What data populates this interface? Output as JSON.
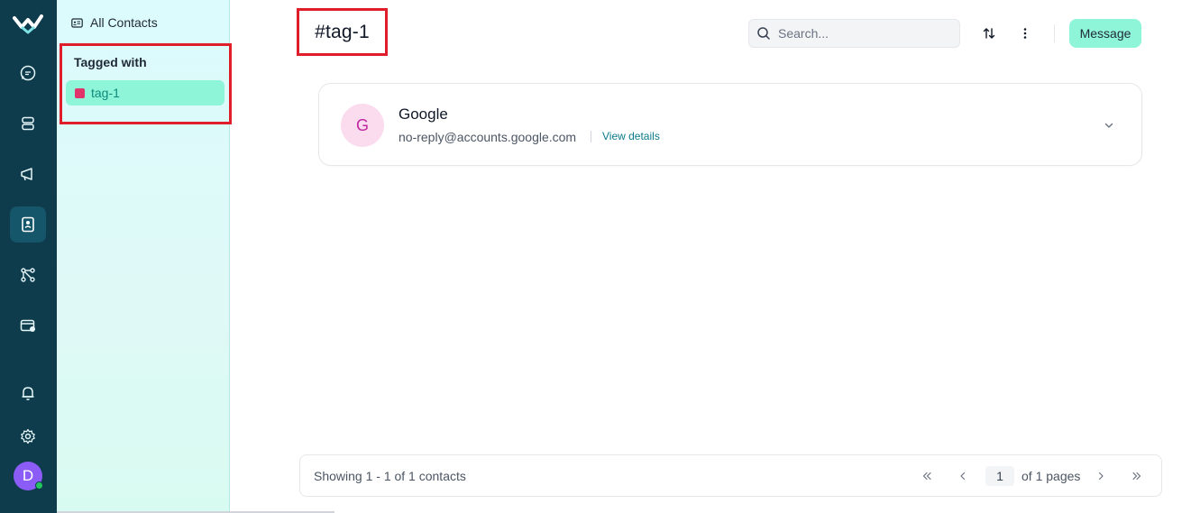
{
  "rail": {
    "icons": [
      "logo-icon",
      "chat-icon",
      "inbox-icon",
      "megaphone-icon",
      "contacts-icon",
      "workflow-icon",
      "wallet-icon",
      "bell-icon",
      "gear-icon"
    ],
    "avatar_initial": "D",
    "colors": {
      "rail_bg": "#0e3c4c",
      "active_bg": "#16566a",
      "avatar_bg": "#8b5cf6",
      "online": "#22c55e"
    }
  },
  "sidebar": {
    "all_contacts_label": "All Contacts",
    "tagged_with_title": "Tagged with",
    "tags": [
      {
        "label": "tag-1",
        "color": "#e0346b",
        "active": true
      }
    ]
  },
  "header": {
    "title": "#tag-1",
    "search_placeholder": "Search...",
    "message_label": "Message"
  },
  "contacts": [
    {
      "initial": "G",
      "name": "Google",
      "email": "no-reply@accounts.google.com",
      "view_details_label": "View details"
    }
  ],
  "pagination": {
    "showing_text": "Showing 1 - 1 of 1 contacts",
    "current_page": "1",
    "of_pages_text": "of 1 pages"
  },
  "accent": {
    "mint": "#8ef5d9",
    "highlight_red": "#e01e2b",
    "link": "#0b7a8a"
  }
}
